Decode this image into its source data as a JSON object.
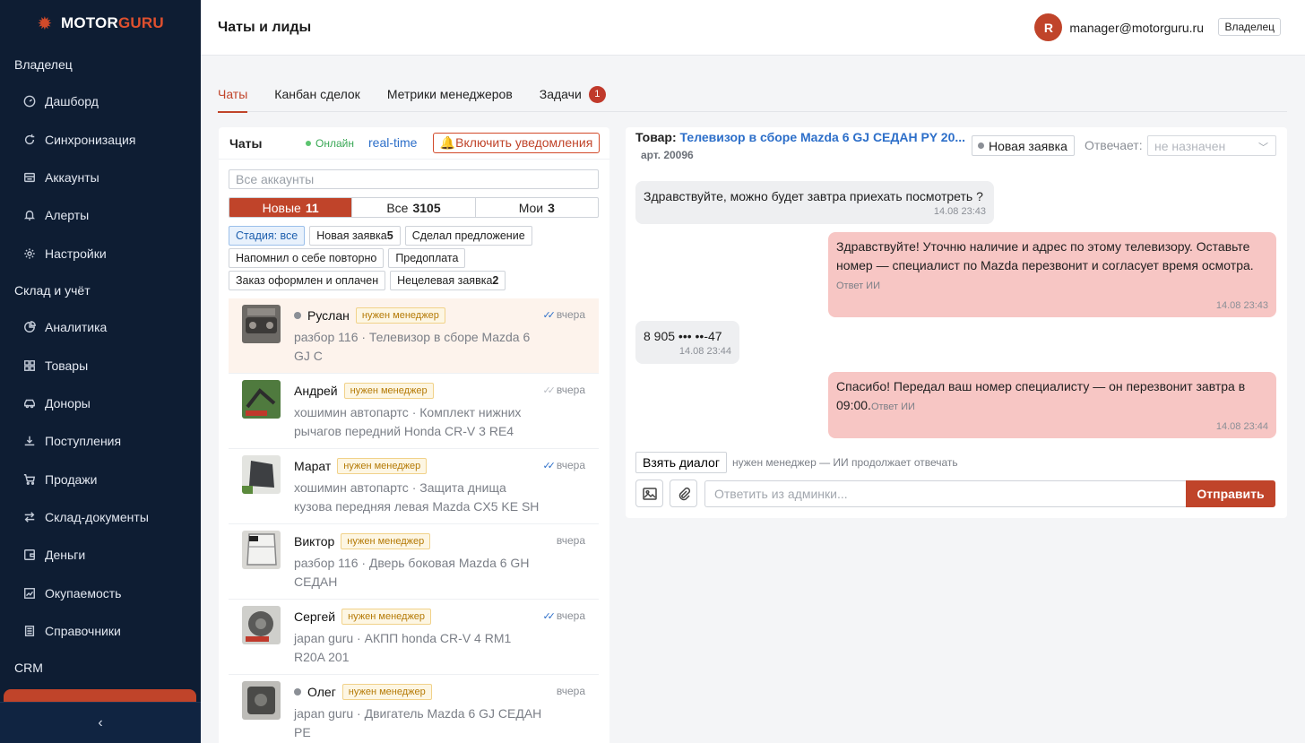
{
  "brand": {
    "part1": "MOTOR",
    "part2": "GURU",
    "icon": "gear-icon"
  },
  "sidebar": {
    "sections": [
      {
        "title": "Владелец",
        "items": [
          {
            "label": "Дашборд",
            "icon": "dashboard-icon"
          },
          {
            "label": "Синхронизация",
            "icon": "sync-icon"
          },
          {
            "label": "Аккаунты",
            "icon": "accounts-icon"
          },
          {
            "label": "Алерты",
            "icon": "bell-icon"
          },
          {
            "label": "Настройки",
            "icon": "settings-icon"
          }
        ]
      },
      {
        "title": "Склад и учёт",
        "items": [
          {
            "label": "Аналитика",
            "icon": "pie-chart-icon"
          },
          {
            "label": "Товары",
            "icon": "grid-icon"
          },
          {
            "label": "Доноры",
            "icon": "car-icon"
          },
          {
            "label": "Поступления",
            "icon": "download-icon"
          },
          {
            "label": "Продажи",
            "icon": "cart-icon"
          },
          {
            "label": "Склад-документы",
            "icon": "swap-icon"
          },
          {
            "label": "Деньги",
            "icon": "wallet-icon"
          },
          {
            "label": "Окупаемость",
            "icon": "line-chart-icon"
          },
          {
            "label": "Справочники",
            "icon": "book-icon"
          }
        ]
      },
      {
        "title": "CRM",
        "items": []
      }
    ],
    "collapse_icon": "chevron-left-icon"
  },
  "header": {
    "title": "Чаты и лиды",
    "user_initial": "R",
    "user_email": "manager@motorguru.ru",
    "role": "Владелец"
  },
  "tabs": [
    {
      "label": "Чаты",
      "active": true
    },
    {
      "label": "Канбан сделок"
    },
    {
      "label": "Метрики менеджеров"
    },
    {
      "label": "Задачи",
      "count": "1"
    }
  ],
  "chats": {
    "title": "Чаты",
    "online": "Онлайн",
    "realtime": "real-time",
    "notify_label": "🔔Включить уведомления",
    "search_placeholder": "Все аккаунты",
    "segments": [
      {
        "label": "Новые",
        "count": "11",
        "active": true
      },
      {
        "label": "Все",
        "count": "3105"
      },
      {
        "label": "Мои",
        "count": "3"
      }
    ],
    "chips": [
      {
        "label": "Стадия: все",
        "count": "",
        "selected": true
      },
      {
        "label": "Новая заявка",
        "count": "5"
      },
      {
        "label": "Сделал предложение",
        "count": ""
      },
      {
        "label": "Напомнил о себе повторно",
        "count": ""
      },
      {
        "label": "Предоплата",
        "count": ""
      },
      {
        "label": "Заказ оформлен и оплачен",
        "count": ""
      },
      {
        "label": "Нецелевая заявка",
        "count": "2"
      }
    ],
    "items": [
      {
        "name": "Руслан",
        "badge": "нужен менеджер",
        "time": "вчера",
        "preview": "разбор 116 · Телевизор в сборе Mazda 6 GJ С",
        "dot": true,
        "ticks": "read",
        "highlight": true
      },
      {
        "name": "Андрей",
        "badge": "нужен менеджер",
        "time": "вчера",
        "preview": "хошимин автопартс · Комплект нижних рычагов передний Honda CR-V 3 RE4",
        "dot": false,
        "ticks": "sent"
      },
      {
        "name": "Марат",
        "badge": "нужен менеджер",
        "time": "вчера",
        "preview": "хошимин автопартс · Защита днища кузова передняя левая Mazda CX5 KE SH",
        "dot": false,
        "ticks": "read"
      },
      {
        "name": "Виктор",
        "badge": "нужен менеджер",
        "time": "вчера",
        "preview": "разбор 116 · Дверь боковая Mazda 6 GH СЕДАН",
        "dot": false,
        "ticks": ""
      },
      {
        "name": "Сергей",
        "badge": "нужен менеджер",
        "time": "вчера",
        "preview": "japan guru · АКПП honda CR-V 4 RM1 R20A 201",
        "dot": false,
        "ticks": "read"
      },
      {
        "name": "Олег",
        "badge": "нужен менеджер",
        "time": "вчера",
        "preview": "japan guru · Двигатель Mazda 6 GJ СЕДАН PE",
        "dot": true,
        "ticks": ""
      }
    ]
  },
  "conversation": {
    "product_label": "Товар:",
    "product_title": "Телевизор в сборе Mazda 6 GJ СЕДАН PY 20...",
    "article": "арт. 20096",
    "status": "Новая заявка",
    "responder_label": "Отвечает:",
    "responder_value": "не назначен",
    "messages": [
      {
        "dir": "in",
        "text": "Здравствуйте, можно будет завтра приехать посмотреть ?",
        "time": "14.08 23:43"
      },
      {
        "dir": "out",
        "text": "Здравствуйте! Уточню наличие и адрес по этому телевизору. Оставьте номер — специалист по Mazda перезвонит и согласует время осмотра.",
        "ai": "Ответ ИИ",
        "time": "14.08 23:43"
      },
      {
        "dir": "in",
        "text": "8 905 ••• ••-47",
        "time": "14.08 23:44"
      },
      {
        "dir": "out",
        "text": "Спасибо! Передал ваш номер специалисту — он перезвонит завтра в 09:00.",
        "ai": "Ответ ИИ",
        "time": "14.08 23:44"
      }
    ],
    "take_label": "Взять диалог",
    "take_note": "нужен менеджер — ИИ продолжает отвечать",
    "reply_placeholder": "Ответить из админки...",
    "send_label": "Отправить"
  },
  "colors": {
    "accent": "#c0442a",
    "sidebar_bg": "#0e1d33",
    "link": "#2d6fc9",
    "out_bubble": "#f7c6c4"
  }
}
